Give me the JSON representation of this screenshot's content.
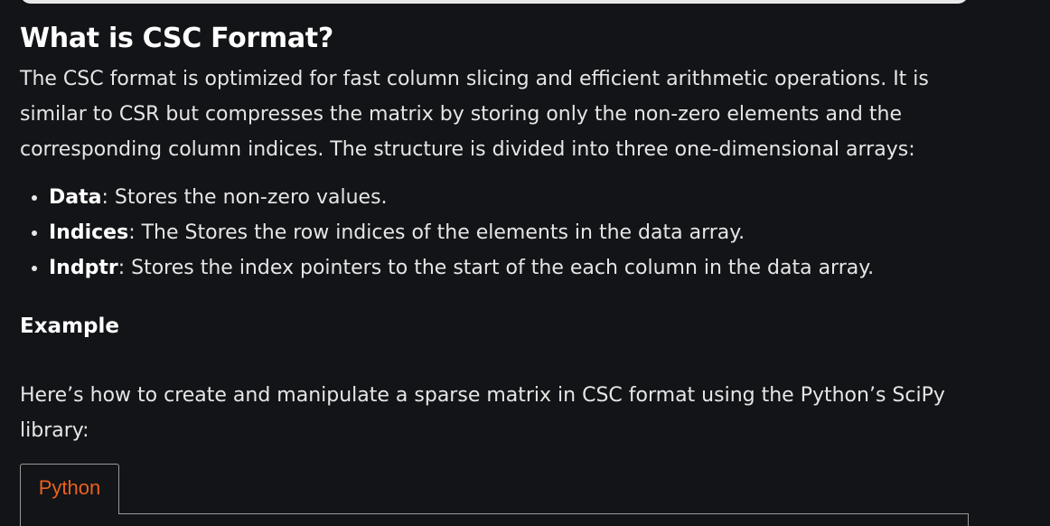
{
  "article": {
    "heading": "What is CSC Format?",
    "intro": "The CSC format is optimized for fast column slicing and efficient arithmetic operations. It is similar to CSR but compresses the matrix by storing only the non-zero elements and the corresponding column indices. The structure is divided into three one-dimensional arrays:",
    "items": [
      {
        "term": "Data",
        "desc": ": Stores the non-zero values."
      },
      {
        "term": "Indices",
        "desc": ": The Stores the row indices of the elements in the data array."
      },
      {
        "term": "Indptr",
        "desc": ": Stores the index pointers to the start of the each column in the data array."
      }
    ],
    "example_heading": "Example",
    "example_text": "Here’s how to create and manipulate a sparse matrix in CSC format using the Python’s SciPy library:"
  },
  "code_tabs": {
    "active_tab": "Python"
  },
  "colors": {
    "background": "#131417",
    "text": "#e6e6e6",
    "tab_accent": "#e8621e"
  }
}
